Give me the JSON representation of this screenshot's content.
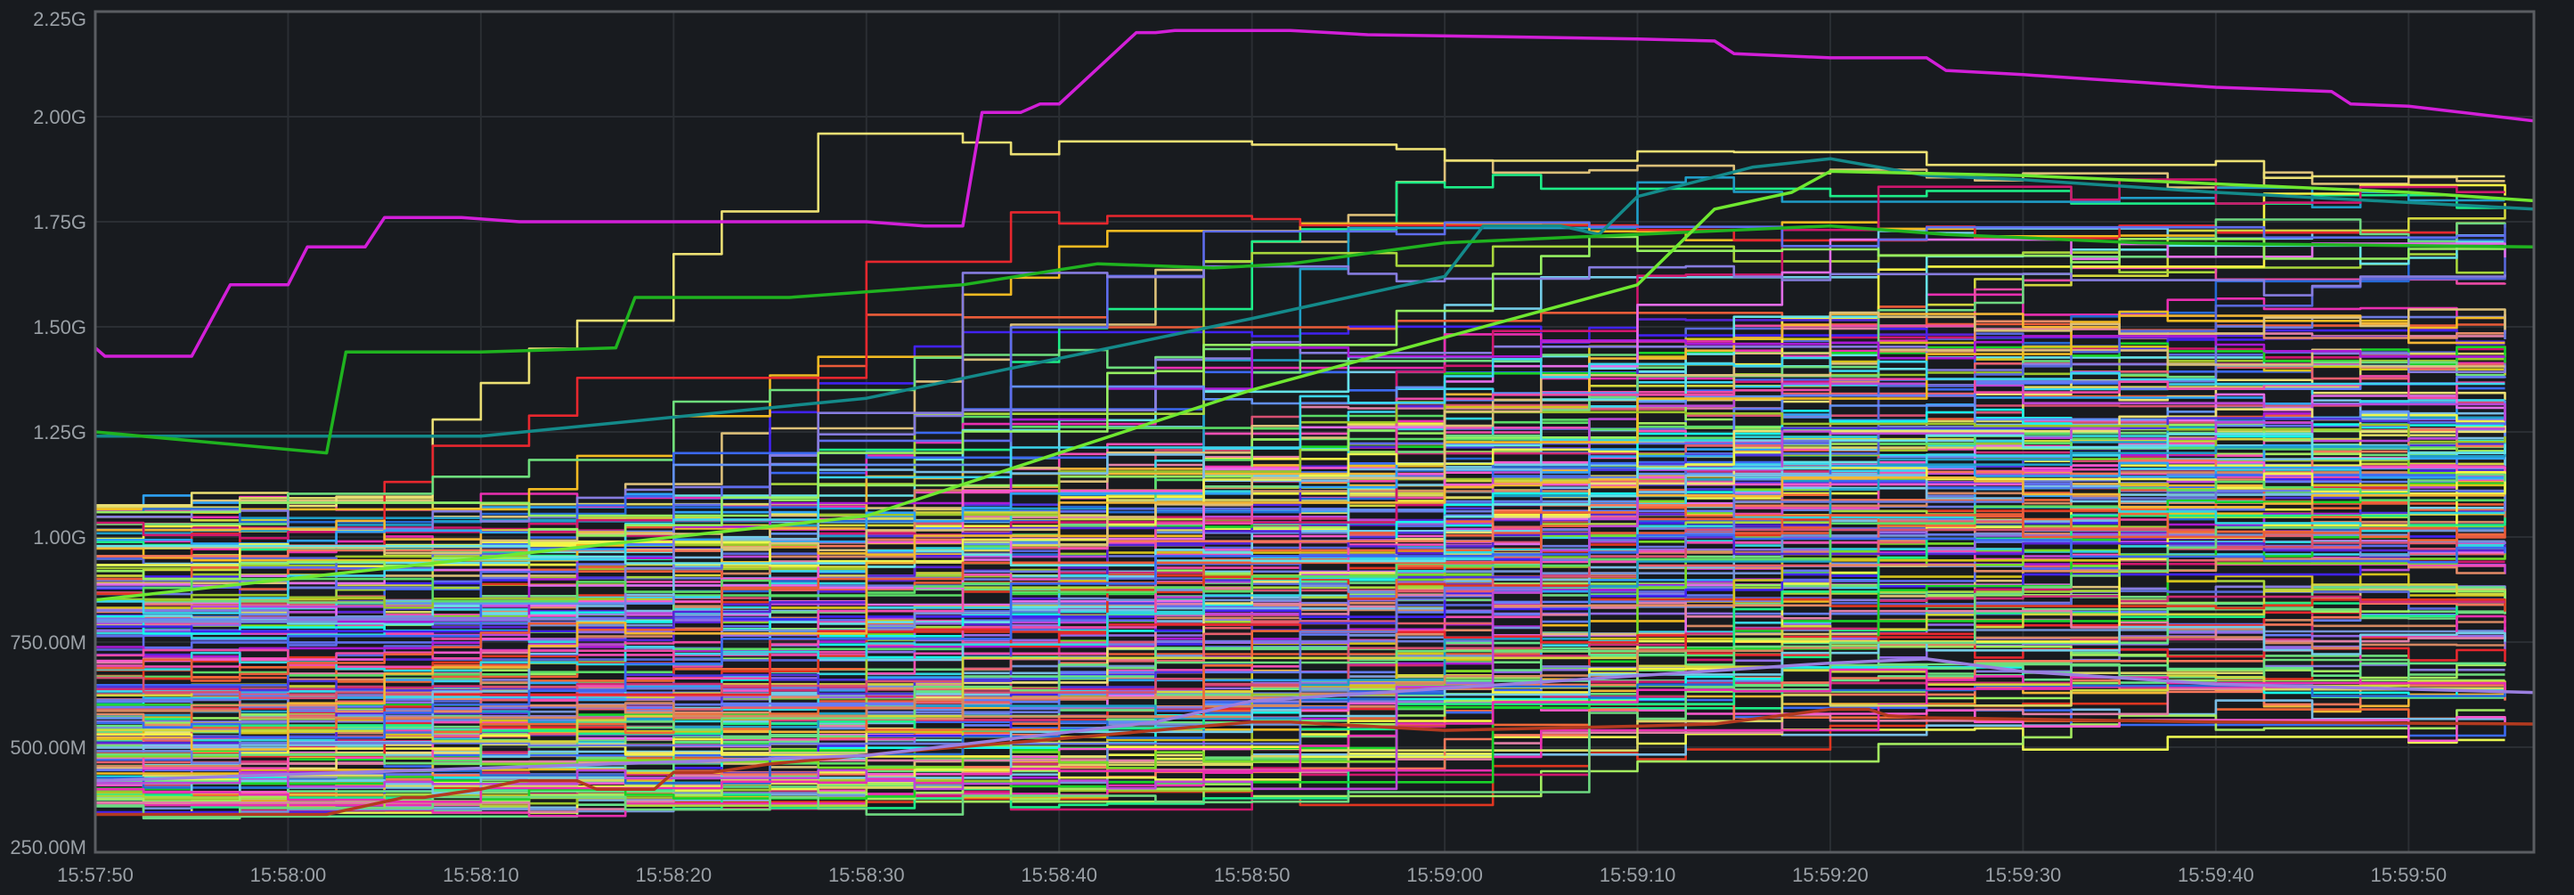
{
  "colors": {
    "background": "#181b1f",
    "plot_border": "#5a5d62",
    "grid": "#2a2e33",
    "tick_label": "#9aa0a6"
  },
  "chart_data": {
    "type": "line",
    "title": "",
    "xlabel": "",
    "ylabel": "",
    "grid": true,
    "legend": "none",
    "x_ticks": [
      "15:57:50",
      "15:58:00",
      "15:58:10",
      "15:58:20",
      "15:58:30",
      "15:58:40",
      "15:58:50",
      "15:59:00",
      "15:59:10",
      "15:59:20",
      "15:59:30",
      "15:59:40",
      "15:59:50"
    ],
    "x_tick_seconds": [
      0,
      10,
      20,
      30,
      40,
      50,
      60,
      70,
      80,
      90,
      100,
      110,
      120
    ],
    "xlim_seconds": [
      0,
      126.5
    ],
    "y_ticks": [
      "250.00M",
      "500.00M",
      "750.00M",
      "1.00G",
      "1.25G",
      "1.50G",
      "1.75G",
      "2.00G",
      "2.25G"
    ],
    "y_tick_values": [
      250000000,
      500000000,
      750000000,
      1000000000,
      1250000000,
      1500000000,
      1750000000,
      2000000000,
      2250000000
    ],
    "ylim": [
      250000000,
      2250000000
    ],
    "series_count": 200,
    "highlighted_series": [
      {
        "color": "#d21fd8",
        "x_seconds": [
          0,
          0.5,
          5,
          7,
          10,
          11,
          14,
          15,
          18,
          19,
          22,
          23,
          28,
          40,
          43,
          45,
          46,
          48,
          49,
          50,
          54,
          55,
          56,
          62,
          66,
          73,
          80,
          84,
          85,
          90,
          95,
          96,
          100,
          110,
          116,
          117,
          120,
          126.5
        ],
        "y": [
          1450000000,
          1430000000,
          1430000000,
          1600000000,
          1600000000,
          1690000000,
          1690000000,
          1760000000,
          1760000000,
          1760000000,
          1750000000,
          1750000000,
          1750000000,
          1750000000,
          1740000000,
          1740000000,
          2010000000,
          2010000000,
          2030000000,
          2030000000,
          2200000000,
          2200000000,
          2205000000,
          2205000000,
          2195000000,
          2190000000,
          2185000000,
          2180000000,
          2150000000,
          2140000000,
          2140000000,
          2110000000,
          2100000000,
          2070000000,
          2060000000,
          2030000000,
          2025000000,
          1990000000
        ]
      },
      {
        "color": "#b33a1f",
        "x_seconds": [
          0,
          12,
          16,
          17,
          20,
          22,
          25,
          26,
          29,
          30,
          32,
          35,
          42,
          50,
          60,
          62,
          70,
          80,
          84,
          90,
          92,
          93,
          95,
          110,
          126.5
        ],
        "y": [
          340000000,
          340000000,
          380000000,
          380000000,
          400000000,
          420000000,
          420000000,
          400000000,
          400000000,
          440000000,
          440000000,
          460000000,
          490000000,
          520000000,
          560000000,
          560000000,
          540000000,
          550000000,
          555000000,
          590000000,
          590000000,
          575000000,
          570000000,
          560000000,
          555000000
        ]
      },
      {
        "color": "#138a8a",
        "x_seconds": [
          0,
          20,
          40,
          60,
          70,
          72,
          76,
          78,
          80,
          86,
          90,
          95,
          100,
          110,
          126.5
        ],
        "y": [
          1240000000,
          1240000000,
          1330000000,
          1520000000,
          1620000000,
          1740000000,
          1740000000,
          1720000000,
          1810000000,
          1880000000,
          1900000000,
          1860000000,
          1850000000,
          1820000000,
          1780000000
        ]
      },
      {
        "color": "#1fb31f",
        "x_seconds": [
          0,
          12,
          13,
          20,
          27,
          28,
          32,
          36,
          45,
          52,
          58,
          62,
          70,
          80,
          90,
          96,
          106,
          126.5
        ],
        "y": [
          1250000000,
          1200000000,
          1440000000,
          1440000000,
          1450000000,
          1570000000,
          1570000000,
          1570000000,
          1600000000,
          1650000000,
          1640000000,
          1650000000,
          1700000000,
          1720000000,
          1740000000,
          1720000000,
          1700000000,
          1690000000
        ]
      },
      {
        "color": "#6fe830",
        "x_seconds": [
          0,
          40,
          60,
          80,
          84,
          88,
          90,
          100,
          110,
          120,
          126.5
        ],
        "y": [
          850000000,
          1050000000,
          1350000000,
          1600000000,
          1780000000,
          1820000000,
          1870000000,
          1860000000,
          1840000000,
          1820000000,
          1800000000
        ]
      },
      {
        "color": "#9a7fe0",
        "x_seconds": [
          0,
          20,
          40,
          55,
          60,
          70,
          80,
          90,
          95,
          100,
          110,
          126.5
        ],
        "y": [
          420000000,
          450000000,
          480000000,
          560000000,
          610000000,
          640000000,
          670000000,
          700000000,
          710000000,
          680000000,
          650000000,
          630000000
        ]
      }
    ]
  }
}
